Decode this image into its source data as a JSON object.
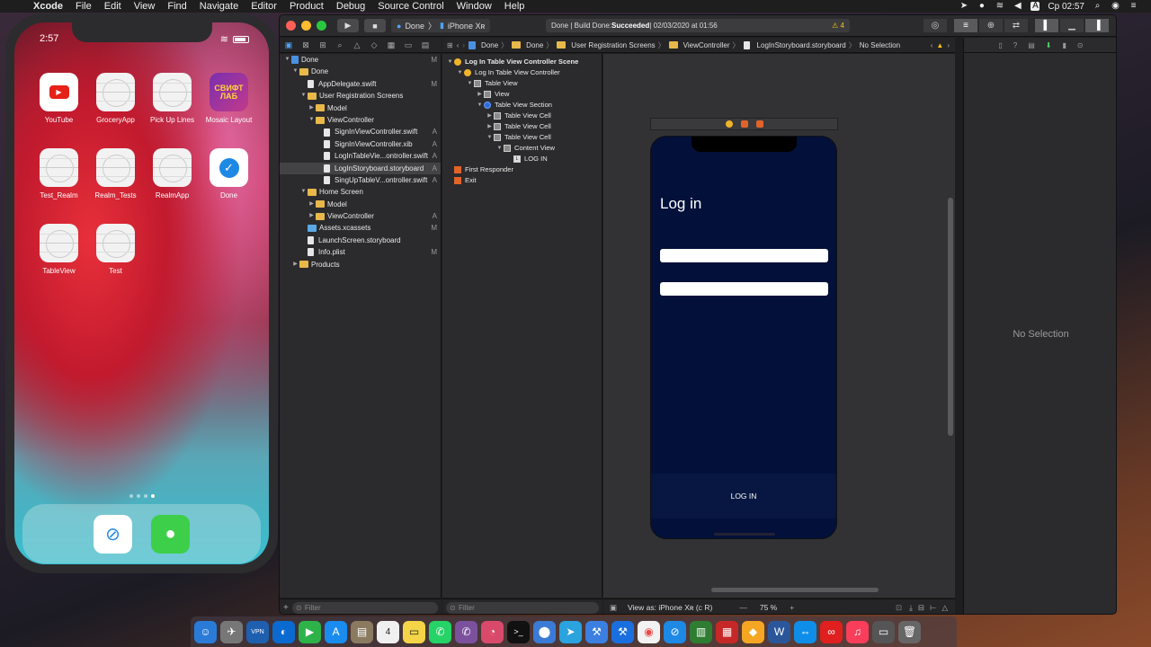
{
  "menubar": {
    "apple": "",
    "app": "Xcode",
    "items": [
      "File",
      "Edit",
      "View",
      "Find",
      "Navigate",
      "Editor",
      "Product",
      "Debug",
      "Source Control",
      "Window",
      "Help"
    ],
    "status_lang": "A",
    "clock": "Ср 02:57"
  },
  "simulator": {
    "time": "2:57",
    "apps": [
      {
        "label": "YouTube",
        "kind": "yt"
      },
      {
        "label": "GroceryApp",
        "kind": "blank"
      },
      {
        "label": "Pick Up Lines",
        "kind": "blank"
      },
      {
        "label": "Mosaic Layout",
        "kind": "swift",
        "text": "СВИФТ ЛАБ"
      },
      {
        "label": "Test_Realm",
        "kind": "blank"
      },
      {
        "label": "Realm_Tests",
        "kind": "blank"
      },
      {
        "label": "RealmApp",
        "kind": "blank"
      },
      {
        "label": "Done",
        "kind": "done"
      },
      {
        "label": "TableView",
        "kind": "blank"
      },
      {
        "label": "Test",
        "kind": "blank"
      }
    ]
  },
  "xcode": {
    "scheme": "Done",
    "device": "iPhone Xʀ",
    "activity_prefix": "Done | Build Done: ",
    "activity_status": "Succeeded",
    "activity_time": " | 02/03/2020 at 01:56",
    "warnings": "⚠ 4",
    "jumpbar": [
      "Done",
      "Done",
      "User Registration Screens",
      "ViewController",
      "LogInStoryboard.storyboard",
      "No Selection"
    ],
    "navigator": [
      {
        "indent": 0,
        "disc": "▼",
        "icon": "proj",
        "label": "Done",
        "badge": "M"
      },
      {
        "indent": 1,
        "disc": "▼",
        "icon": "folder",
        "label": "Done",
        "badge": ""
      },
      {
        "indent": 2,
        "disc": "",
        "icon": "file",
        "label": "AppDelegate.swift",
        "badge": "M"
      },
      {
        "indent": 2,
        "disc": "▼",
        "icon": "folder",
        "label": "User Registration Screens",
        "badge": ""
      },
      {
        "indent": 3,
        "disc": "▶",
        "icon": "folder",
        "label": "Model",
        "badge": ""
      },
      {
        "indent": 3,
        "disc": "▼",
        "icon": "folder",
        "label": "ViewController",
        "badge": ""
      },
      {
        "indent": 4,
        "disc": "",
        "icon": "file",
        "label": "SignInViewController.swift",
        "badge": "A"
      },
      {
        "indent": 4,
        "disc": "",
        "icon": "file",
        "label": "SignInViewController.xib",
        "badge": "A"
      },
      {
        "indent": 4,
        "disc": "",
        "icon": "file",
        "label": "LogInTableVie...ontroller.swift",
        "badge": "A"
      },
      {
        "indent": 4,
        "disc": "",
        "icon": "file",
        "label": "LogInStoryboard.storyboard",
        "badge": "A",
        "selected": true
      },
      {
        "indent": 4,
        "disc": "",
        "icon": "file",
        "label": "SingUpTableV...ontroller.swift",
        "badge": "A"
      },
      {
        "indent": 2,
        "disc": "▼",
        "icon": "folder",
        "label": "Home Screen",
        "badge": ""
      },
      {
        "indent": 3,
        "disc": "▶",
        "icon": "folder",
        "label": "Model",
        "badge": ""
      },
      {
        "indent": 3,
        "disc": "▶",
        "icon": "folder",
        "label": "ViewController",
        "badge": "A"
      },
      {
        "indent": 2,
        "disc": "",
        "icon": "assets",
        "label": "Assets.xcassets",
        "badge": "M"
      },
      {
        "indent": 2,
        "disc": "",
        "icon": "file",
        "label": "LaunchScreen.storyboard",
        "badge": ""
      },
      {
        "indent": 2,
        "disc": "",
        "icon": "file",
        "label": "Info.plist",
        "badge": "M"
      },
      {
        "indent": 1,
        "disc": "▶",
        "icon": "folder",
        "label": "Products",
        "badge": ""
      }
    ],
    "outline": [
      {
        "indent": 0,
        "disc": "▼",
        "icon": "yellow",
        "label": "Log In Table View Controller Scene",
        "bold": true
      },
      {
        "indent": 1,
        "disc": "▼",
        "icon": "yellow",
        "label": "Log In Table View Controller"
      },
      {
        "indent": 2,
        "disc": "▼",
        "icon": "plain",
        "label": "Table View"
      },
      {
        "indent": 3,
        "disc": "▶",
        "icon": "plain",
        "label": "View"
      },
      {
        "indent": 3,
        "disc": "▼",
        "icon": "blue",
        "label": "Table View Section"
      },
      {
        "indent": 4,
        "disc": "▶",
        "icon": "plain",
        "label": "Table View Cell"
      },
      {
        "indent": 4,
        "disc": "▶",
        "icon": "plain",
        "label": "Table View Cell"
      },
      {
        "indent": 4,
        "disc": "▼",
        "icon": "plain",
        "label": "Table View Cell"
      },
      {
        "indent": 5,
        "disc": "▼",
        "icon": "plain",
        "label": "Content View"
      },
      {
        "indent": 6,
        "disc": "",
        "icon": "lbl",
        "label": "LOG IN"
      },
      {
        "indent": 0,
        "disc": "",
        "icon": "orange",
        "label": "First Responder"
      },
      {
        "indent": 0,
        "disc": "",
        "icon": "orange",
        "label": "Exit"
      }
    ],
    "filter_placeholder": "Filter",
    "device_screen": {
      "title": "Log in",
      "button": "LOG IN"
    },
    "view_as": "View as: iPhone Xʀ (",
    "view_as_suffix": "C",
    "view_as_end": "R)",
    "zoom": "75 %",
    "inspector_empty": "No Selection"
  }
}
